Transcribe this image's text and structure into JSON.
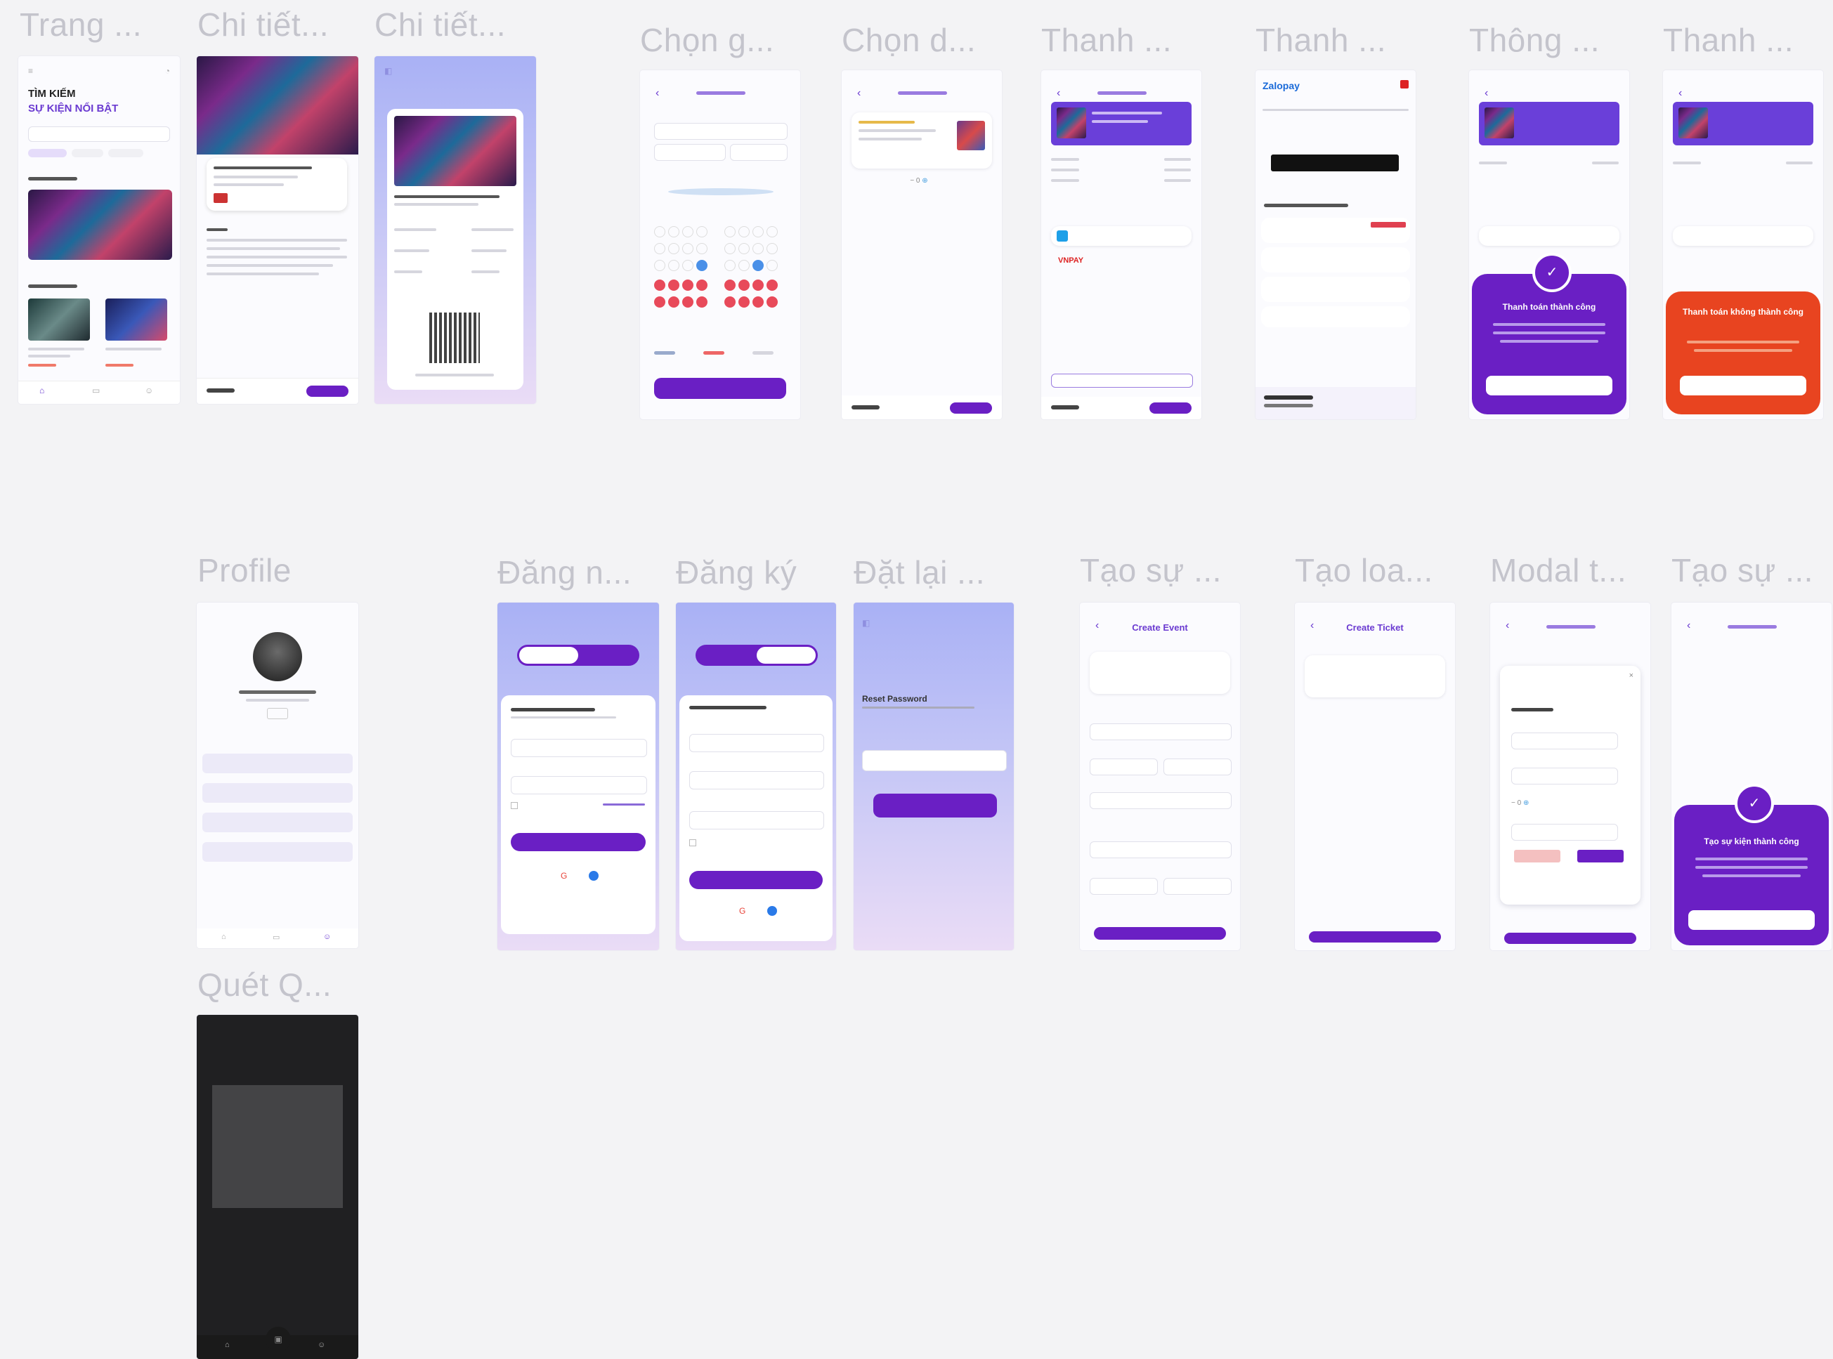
{
  "frames": {
    "home": {
      "label": "Trang ...",
      "title_line1": "TÌM KIẾM",
      "title_line2": "SỰ KIỆN NỔI BẬT"
    },
    "detail1": {
      "label": "Chi tiết..."
    },
    "detail2": {
      "label": "Chi tiết..."
    },
    "choose_seat": {
      "label": "Chọn g..."
    },
    "choose_d": {
      "label": "Chọn d..."
    },
    "pay1": {
      "label": "Thanh ..."
    },
    "pay2": {
      "label": "Thanh ...",
      "brand": "Zalopay"
    },
    "notice": {
      "label": "Thông ...",
      "modal_title": "Thanh toán thành công"
    },
    "pay3": {
      "label": "Thanh ...",
      "modal_title": "Thanh toán không thành công"
    },
    "profile": {
      "label": "Profile"
    },
    "login": {
      "label": "Đăng n..."
    },
    "register": {
      "label": "Đăng ký"
    },
    "reset": {
      "label": "Đặt lại ...",
      "title": "Reset Password"
    },
    "create_event": {
      "label": "Tạo sự ...",
      "title": "Create Event"
    },
    "create_ticket": {
      "label": "Tạo loa...",
      "title": "Create Ticket"
    },
    "modal_t": {
      "label": "Modal t..."
    },
    "create_event_done": {
      "label": "Tạo sự ...",
      "modal_title": "Tạo sự kiện thành công"
    },
    "scan_qr": {
      "label": "Quét Q..."
    }
  }
}
